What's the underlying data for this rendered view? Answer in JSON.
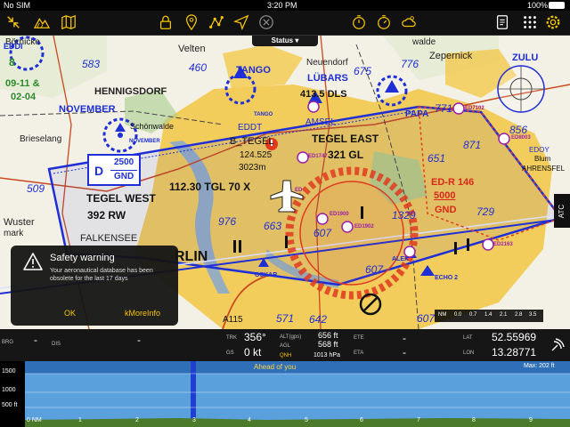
{
  "status_bar": {
    "carrier": "No SIM",
    "time": "3:20 PM",
    "battery": "100%"
  },
  "toolbar": {
    "left_icons": [
      "collapse-icon",
      "terrain-icon",
      "map-book-icon"
    ],
    "center_icons": [
      "lock-icon",
      "waypoint-pin-icon",
      "route-icon",
      "direct-to-icon",
      "close-circle-icon"
    ],
    "right_icons": [
      "stopwatch-icon",
      "timer-icon",
      "weather-icon",
      "document-icon",
      "grid-menu-icon",
      "settings-icon"
    ],
    "accent": "#f5c400"
  },
  "status_tab": {
    "label": "Status"
  },
  "map": {
    "labels": {
      "bornicke": "Börnicke",
      "velten": "Velten",
      "tango": "TANGO",
      "neuendorf": "Neuendorf",
      "walde": "walde",
      "zepernick": "Zepernick",
      "zulu": "ZULU",
      "hennigsdorf": "HENNIGSDORF",
      "lubars": "LÜBARS",
      "dls": "413.5 DLS",
      "november": "NOVEMBER",
      "november_small": "NOVEMBER",
      "schonwalde": "Schönwalde",
      "tango_small": "TANGO",
      "papa": "PAPA",
      "brieselang": "Brieselang",
      "eddt": "EDDT",
      "amsel": "AMSEL",
      "b_tegel": "B_TEGEL",
      "tegel_freq": "124.525",
      "tegel_elev": "3023m",
      "tegel_east": "TEGEL EAST",
      "tegel_east_freq": "321 GL",
      "tegel_west_freq": "112.30 TGL 70 X",
      "tegel_west": "TEGEL WEST",
      "tegel_west_sub": "392 RW",
      "airspace_top": "2500",
      "airspace_bottom": "GND",
      "airspace_class": "D",
      "ed_r": "ED-R 146",
      "ed_r_top": "5000",
      "ed_r_bottom": "GND",
      "wuster": "Wuster",
      "mark": "mark",
      "falkensee": "FALKENSEE",
      "berlin": "RLIN",
      "ahrensfel": "AHRENSFEL",
      "edoy": "EDOY",
      "blum": "Blum",
      "oskar": "OSKAR",
      "alex": "ALEX",
      "echo": "ECHO 2",
      "a115": "A115",
      "ed1900": "ED1900",
      "ed1902": "ED1902",
      "ed2163": "ED2163",
      "ed1747": "ED1747",
      "ed7102": "ED7102",
      "ed8003": "ED8003",
      "ed1905": "ED1905",
      "ed_small": "ED",
      "eddi": "EDDI",
      "elevations": [
        "583",
        "460",
        "675",
        "776",
        "771",
        "856",
        "871",
        "651",
        "729",
        "509",
        "976",
        "663",
        "607",
        "1329",
        "607",
        "571",
        "642",
        "607"
      ],
      "vfr_8": "8",
      "vfr_dates": "09-11 &",
      "vfr_dates2": "02-04"
    }
  },
  "dialog": {
    "title": "Safety warning",
    "message": "Your aeronautical database has been obsolete for the last 17 days",
    "ok": "OK",
    "more": "kMoreInfo"
  },
  "atc_tab": {
    "label": "ATC"
  },
  "scale_bar": {
    "unit": "NM",
    "ticks": [
      "0.0",
      "0.7",
      "1.4",
      "2.1",
      "2.8",
      "3.5"
    ]
  },
  "instruments": {
    "brg_label": "BRG",
    "brg_value": "-",
    "dis_label": "DIS",
    "dis_value": "-",
    "trk_label": "TRK",
    "trk_value": "356°",
    "gs_label": "GS",
    "gs_value": "0 kt",
    "alt_label": "ALT(gps)",
    "alt_value": "656 ft",
    "agl_label": "AGL",
    "agl_value": "568 ft",
    "qnh_label": "QNH",
    "qnh_value": "1013 hPa",
    "ete_label": "ETE",
    "ete_value": "-",
    "eta_label": "ETA",
    "eta_value": "-",
    "lat_label": "LAT",
    "lat_value": "52.55969",
    "lon_label": "LON",
    "lon_value": "13.28771"
  },
  "profile": {
    "ahead_label": "Ahead of you",
    "max_label": "Max: 202 ft",
    "alt_ticks": [
      "1500",
      "1000",
      "500 ft"
    ],
    "nm_label": "0 NM",
    "distance_ticks": [
      "1",
      "2",
      "3",
      "4",
      "5",
      "6",
      "7",
      "8",
      "9"
    ]
  },
  "colors": {
    "map_bg": "#f3f1e6",
    "urban_yellow": "#f2c94c",
    "airspace_blue": "#1f2fd6",
    "restricted_red": "#e03a1e",
    "water_blue": "#7ea6d8",
    "vfr_green": "#2b8a2b"
  }
}
